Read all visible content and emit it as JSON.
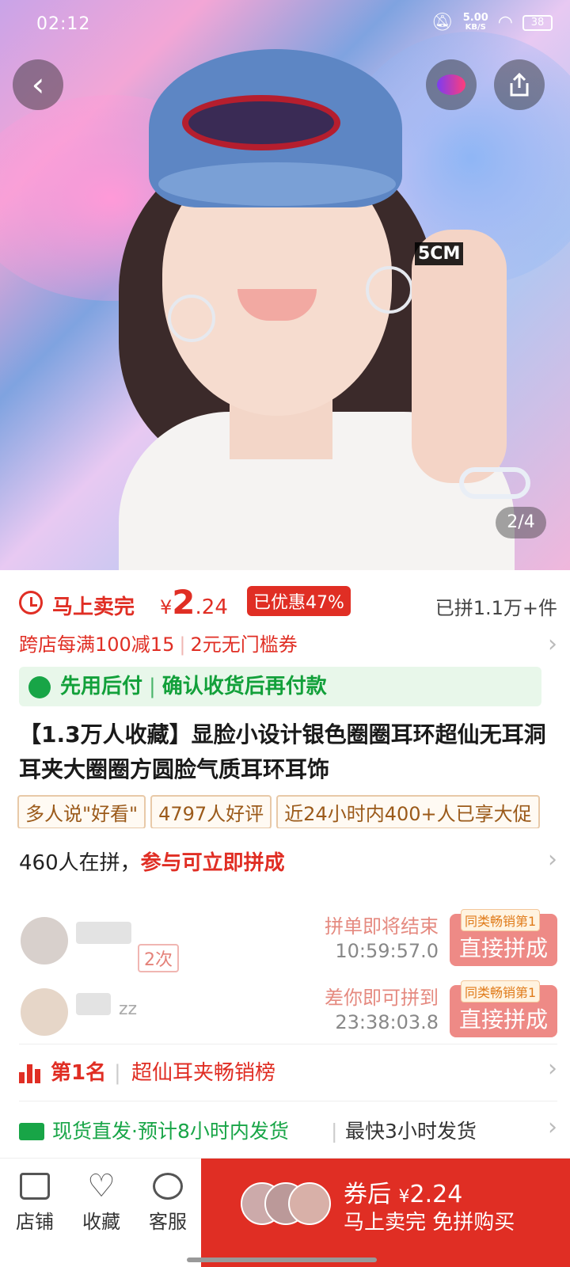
{
  "status": {
    "time": "02:12",
    "net_speed": "5.00",
    "net_unit": "KB/S",
    "battery": "38"
  },
  "gallery": {
    "image_label": "5CM",
    "pager": "2/4"
  },
  "price": {
    "sell_label": "马上卖完",
    "currency": "¥",
    "integer": "2",
    "decimal": ".24",
    "discount": "已优惠47%",
    "sold": "已拼1.1万+件"
  },
  "coupons": {
    "first": "跨店每满100减15",
    "second": "2元无门槛券"
  },
  "pay_later": {
    "title": "先用后付",
    "desc": "确认收货后再付款"
  },
  "product_title": "【1.3万人收藏】显脸小设计银色圈圈耳环超仙无耳洞耳夹大圈圈方圆脸气质耳环耳饰",
  "tags": [
    "多人说\"好看\"",
    "4797人好评",
    "近24小时内400+人已享大促"
  ],
  "group": {
    "count_text": "460人在拼，",
    "action_text": "参与可立即拼成"
  },
  "pins": [
    {
      "times": "2次",
      "hint": "拼单即将结束",
      "timer": "10:59:57.0",
      "badge": "同类畅销第1",
      "button": "直接拼成"
    },
    {
      "name_tail": "zz",
      "hint": "差你即可拼到",
      "timer": "23:38:03.8",
      "badge": "同类畅销第1",
      "button": "直接拼成"
    }
  ],
  "rank": {
    "place": "第1名",
    "list": "超仙耳夹畅销榜"
  },
  "shipping": {
    "main": "现货直发·预计8小时内发货",
    "fast": "最快3小时发货"
  },
  "bottom": {
    "store": "店铺",
    "favorite": "收藏",
    "service": "客服",
    "buy_line1_prefix": "券后",
    "buy_currency": "¥",
    "buy_price": "2.24",
    "buy_line2": "马上卖完 免拼购买"
  },
  "colors": {
    "accent": "#e02e24",
    "green": "#18a547"
  }
}
